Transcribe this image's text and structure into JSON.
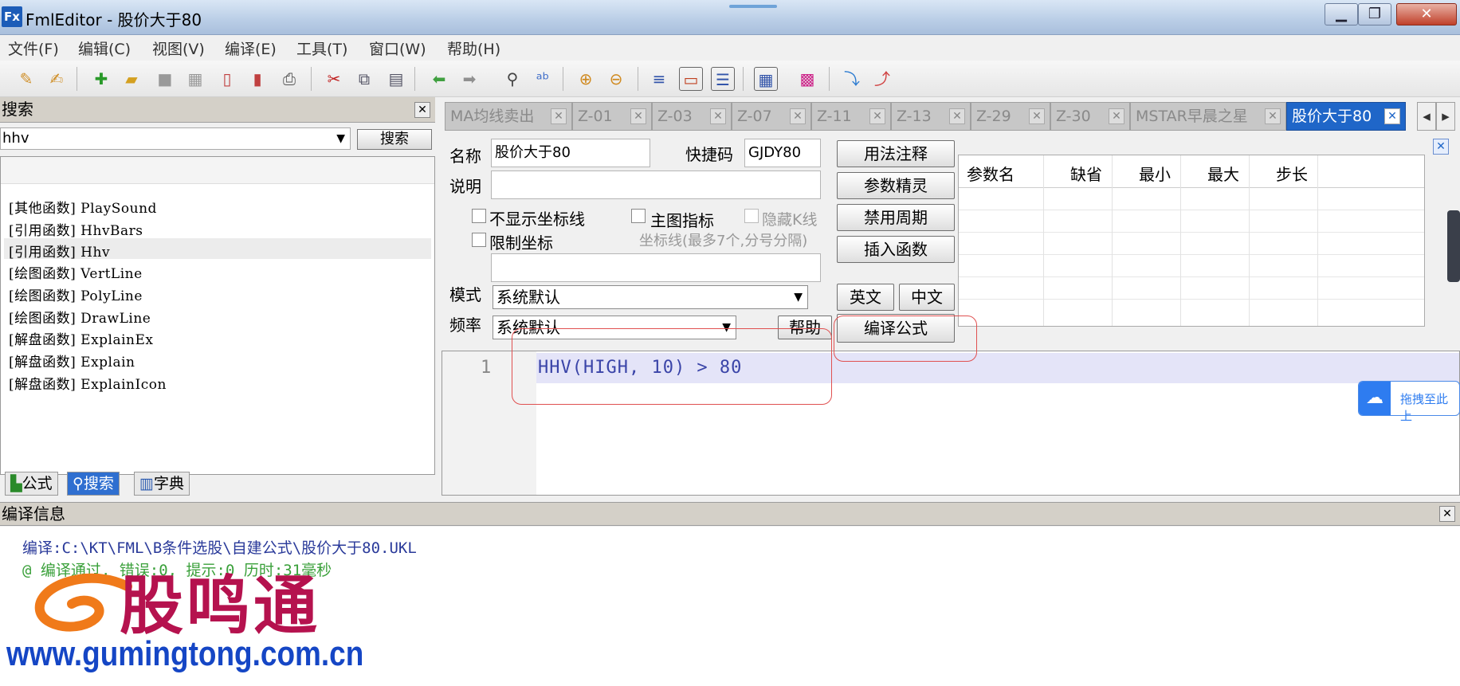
{
  "titlebar": {
    "title": "FmlEditor - 股价大于80",
    "icon_text": "Fx"
  },
  "menus": [
    "文件(F)",
    "编辑(C)",
    "视图(V)",
    "编译(E)",
    "工具(T)",
    "窗口(W)",
    "帮助(H)"
  ],
  "search_panel": {
    "title": "搜索",
    "query": "hhv",
    "button": "搜索",
    "results": [
      "[其他函数] PlaySound",
      "[引用函数] HhvBars",
      "[引用函数] Hhv",
      "[绘图函数] VertLine",
      "[绘图函数] PolyLine",
      "[绘图函数] DrawLine",
      "[解盘函数] ExplainEx",
      "[解盘函数] Explain",
      "[解盘函数] ExplainIcon"
    ],
    "bottom_tabs": [
      "公式",
      "搜索",
      "字典"
    ]
  },
  "tabs": [
    "MA均线卖出",
    "Z-01",
    "Z-03",
    "Z-07",
    "Z-11",
    "Z-13",
    "Z-29",
    "Z-30",
    "MSTAR早晨之星",
    "股价大于80"
  ],
  "form": {
    "name_label": "名称",
    "name_value": "股价大于80",
    "shortcut_label": "快捷码",
    "shortcut_value": "GJDY80",
    "desc_label": "说明",
    "chk_no_axis": "不显示坐标线",
    "chk_main_chart": "主图指标",
    "chk_hide_k": "隐藏K线",
    "chk_limit_axis": "限制坐标",
    "axis_hint": "坐标线(最多7个,分号分隔)",
    "mode_label": "模式",
    "mode_value": "系统默认",
    "freq_label": "频率",
    "freq_value": "系统默认",
    "btn_usage": "用法注释",
    "btn_param": "参数精灵",
    "btn_disable": "禁用周期",
    "btn_insert": "插入函数",
    "btn_en": "英文",
    "btn_cn": "中文",
    "btn_help": "帮助",
    "btn_compile": "编译公式"
  },
  "param_grid": {
    "headers": [
      "参数名",
      "缺省",
      "最小",
      "最大",
      "步长"
    ]
  },
  "editor": {
    "line_no": "1",
    "code": "HHV(HIGH, 10) > 80"
  },
  "compile": {
    "title": "编译信息",
    "line1": "编译:C:\\KT\\FML\\B条件选股\\自建公式\\股价大于80.UKL",
    "line2": "@ 编译通过, 错误:0, 提示:0 历时:31毫秒"
  },
  "drag_badge": "拖拽至此上",
  "watermark": {
    "logo": "股鸣通",
    "url": "www.gumingtong.com.cn"
  },
  "colors": {
    "tab_active": "#1f66c8",
    "code": "#3a44a8",
    "highlight_box": "#e05050",
    "watermark_red": "#b5124e",
    "watermark_blue": "#1546c5"
  }
}
